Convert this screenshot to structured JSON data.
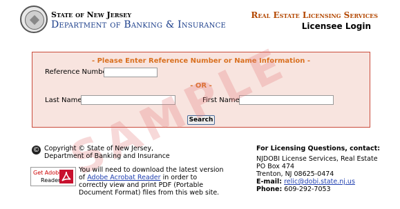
{
  "header": {
    "state_name": "State of New Jersey",
    "dept_name": "Department of Banking & Insurance",
    "service_title": "Real Estate Licensing Services",
    "login_title": "Licensee Login"
  },
  "form": {
    "heading": "- Please Enter Reference Number or Name Information -",
    "reference_label": "Reference Number:",
    "reference_value": "",
    "or_text": "- OR -",
    "last_name_label": "Last Name:",
    "last_name_value": "",
    "first_name_label": "First Name:",
    "first_name_value": "",
    "search_label": "Search"
  },
  "watermark": "SAMPLE",
  "footer": {
    "copyright_line1": "Copyright © State of New Jersey,",
    "copyright_line2": "Department of Banking and Insurance",
    "adobe_get": "Get Adobe",
    "adobe_product": "Reader",
    "download_pre": "You will need to download the latest version of",
    "download_link": "Adobe Acrobat Reader",
    "download_post": "in order to correctly view and print PDF (Portable Document Format) files from this web site.",
    "contact_heading": "For Licensing Questions, contact:",
    "contact_org": "NJDOBI License Services, Real Estate",
    "contact_po": "PO Box 474",
    "contact_city": "Trenton, NJ 08625-0474",
    "email_label": "E-mail:",
    "email_value": "relic@dobi.state.nj.us",
    "phone_label": "Phone:",
    "phone_value": "609-292-7053"
  },
  "colors": {
    "dept_blue": "#1a3d8a",
    "service_orange": "#b34700",
    "form_bg": "#f8e4df",
    "form_border": "#c94a3a",
    "heading_orange": "#d9701f",
    "link_blue": "#1f3fb0"
  },
  "icons": {
    "seal": "state-seal-icon",
    "copyright": "copyright-icon",
    "adobe": "adobe-reader-icon"
  }
}
